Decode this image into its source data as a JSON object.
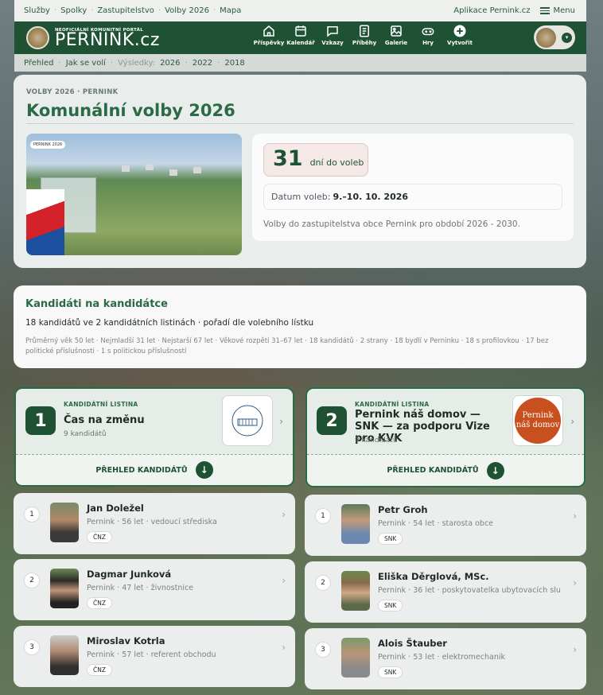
{
  "topbar": {
    "links": [
      "Služby",
      "Spolky",
      "Zastupitelstvo",
      "Volby 2026",
      "Mapa"
    ],
    "app": "Aplikace Pernink.cz",
    "menu": "Menu"
  },
  "brand": {
    "tag": "NEOFICIÁLNÍ KOMUNITNÍ PORTÁL",
    "name": "PERNINK.cz"
  },
  "nav": [
    {
      "label": "Příspěvky",
      "icon": "home-icon"
    },
    {
      "label": "Kalendář",
      "icon": "calendar-icon"
    },
    {
      "label": "Vzkazy",
      "icon": "message-icon"
    },
    {
      "label": "Příběhy",
      "icon": "document-icon"
    },
    {
      "label": "Galerie",
      "icon": "image-icon"
    },
    {
      "label": "Hry",
      "icon": "gamepad-icon"
    },
    {
      "label": "Vytvořit",
      "icon": "plus-circle-icon"
    }
  ],
  "subnav": {
    "overview": "Přehled",
    "how": "Jak se volí",
    "results": "Výsledky:",
    "y1": "2026",
    "y2": "2022",
    "y3": "2018"
  },
  "hero": {
    "kicker": "VOLBY 2026 · PERNINK",
    "title": "Komunální volby 2026",
    "photo_pill": "PERNINK 2026",
    "days": "31",
    "days_label": "dní do voleb",
    "date_label": "Datum voleb:",
    "date_value": "9.–10. 10. 2026",
    "desc": "Volby do zastupitelstva obce Pernink pro období 2026 - 2030."
  },
  "summary": {
    "title": "Kandidáti na kandidátce",
    "line1": "18 kandidátů ve 2 kandidátních listinách · pořadí dle volebního lístku",
    "line2": "Průměrný věk 50 let · Nejmladší 31 let · Nejstarší 67 let · Věkové rozpětí 31–67 let · 18 kandidátů · 2 strany · 18 bydlí v Perninku · 18 s profilovkou · 17 bez politické příslušnosti · 1 s politickou příslušností"
  },
  "parties": [
    {
      "num": "1",
      "label": "KANDIDÁTNÍ LISTINA",
      "name": "Čas na změnu",
      "count": "9 kandidátů",
      "overview": "PŘEHLED KANDIDÁTŮ",
      "logo_text": "Čas na změnu"
    },
    {
      "num": "2",
      "label": "KANDIDÁTNÍ LISTINA",
      "name": "Pernink náš domov — SNK — za podporu Vize pro KVK",
      "count": "9 kandidátů",
      "overview": "PŘEHLED KANDIDÁTŮ",
      "logo_text": "Pernink náš domov"
    }
  ],
  "candidates_left": [
    {
      "pos": "1",
      "name": "Jan Doležel",
      "meta": "Pernink · 56 let · vedoucí střediska",
      "tag": "ČNZ"
    },
    {
      "pos": "2",
      "name": "Dagmar Junková",
      "meta": "Pernink · 47 let · živnostnice",
      "tag": "ČNZ"
    },
    {
      "pos": "3",
      "name": "Miroslav Kotrla",
      "meta": "Pernink · 57 let · referent obchodu",
      "tag": "ČNZ"
    }
  ],
  "candidates_right": [
    {
      "pos": "1",
      "name": "Petr Groh",
      "meta": "Pernink · 54 let · starosta obce",
      "tag": "SNK"
    },
    {
      "pos": "2",
      "name": "Eliška Děrglová, MSc.",
      "meta": "Pernink · 36 let · poskytovatelka ubytovacích slu…",
      "tag": "SNK"
    },
    {
      "pos": "3",
      "name": "Alois Štauber",
      "meta": "Pernink · 53 let · elektromechanik",
      "tag": "SNK"
    }
  ],
  "colors": {
    "brand_green": "#1f5235",
    "accent_green": "#2a6a45",
    "party2_logo": "#c8501e"
  }
}
